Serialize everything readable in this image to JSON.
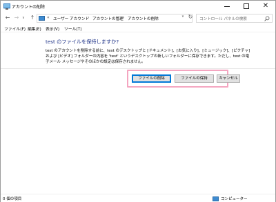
{
  "window": {
    "title": "アカウントの削除",
    "minimize_glyph": "—",
    "maximize_glyph": "☐",
    "close_glyph": "✕"
  },
  "nav": {
    "back_glyph": "←",
    "forward_glyph": "→",
    "history_glyph": "∨",
    "up_glyph": "↑",
    "separator": "«",
    "breadcrumb": [
      "ユーザー アカウント",
      "アカウントの管理",
      "アカウントの削除"
    ],
    "crumb_separator": "›",
    "dropdown_glyph": "∨",
    "refresh_glyph": "↻"
  },
  "search": {
    "placeholder": "コントロール パネルの検索"
  },
  "menu": {
    "items": [
      "ファイル(F)",
      "編集(E)",
      "表示(V)",
      "ツール(T)"
    ]
  },
  "content": {
    "heading": "test のファイルを保持しますか?",
    "description": "test のアカウントを削除する前に、test のデスクトップと [ドキュメント]、[お気に入り]、[ミュージック]、[ピクチャ] および [ビデオ] フォルダーの内容を 'test' というデスクトップの新しいフォルダーに保存できます。ただし、test の電子メール メッセージやそのほかの設定は保存されません。"
  },
  "buttons": {
    "delete_files": "ファイルの削除",
    "keep_files": "ファイルの保持",
    "cancel": "キャンセル"
  },
  "status": {
    "item_count": "0 個の項目",
    "location": "コンピューター"
  },
  "colors": {
    "heading": "#1e3287",
    "highlight": "#f4a5c0",
    "default_button_border": "#0078d7"
  }
}
